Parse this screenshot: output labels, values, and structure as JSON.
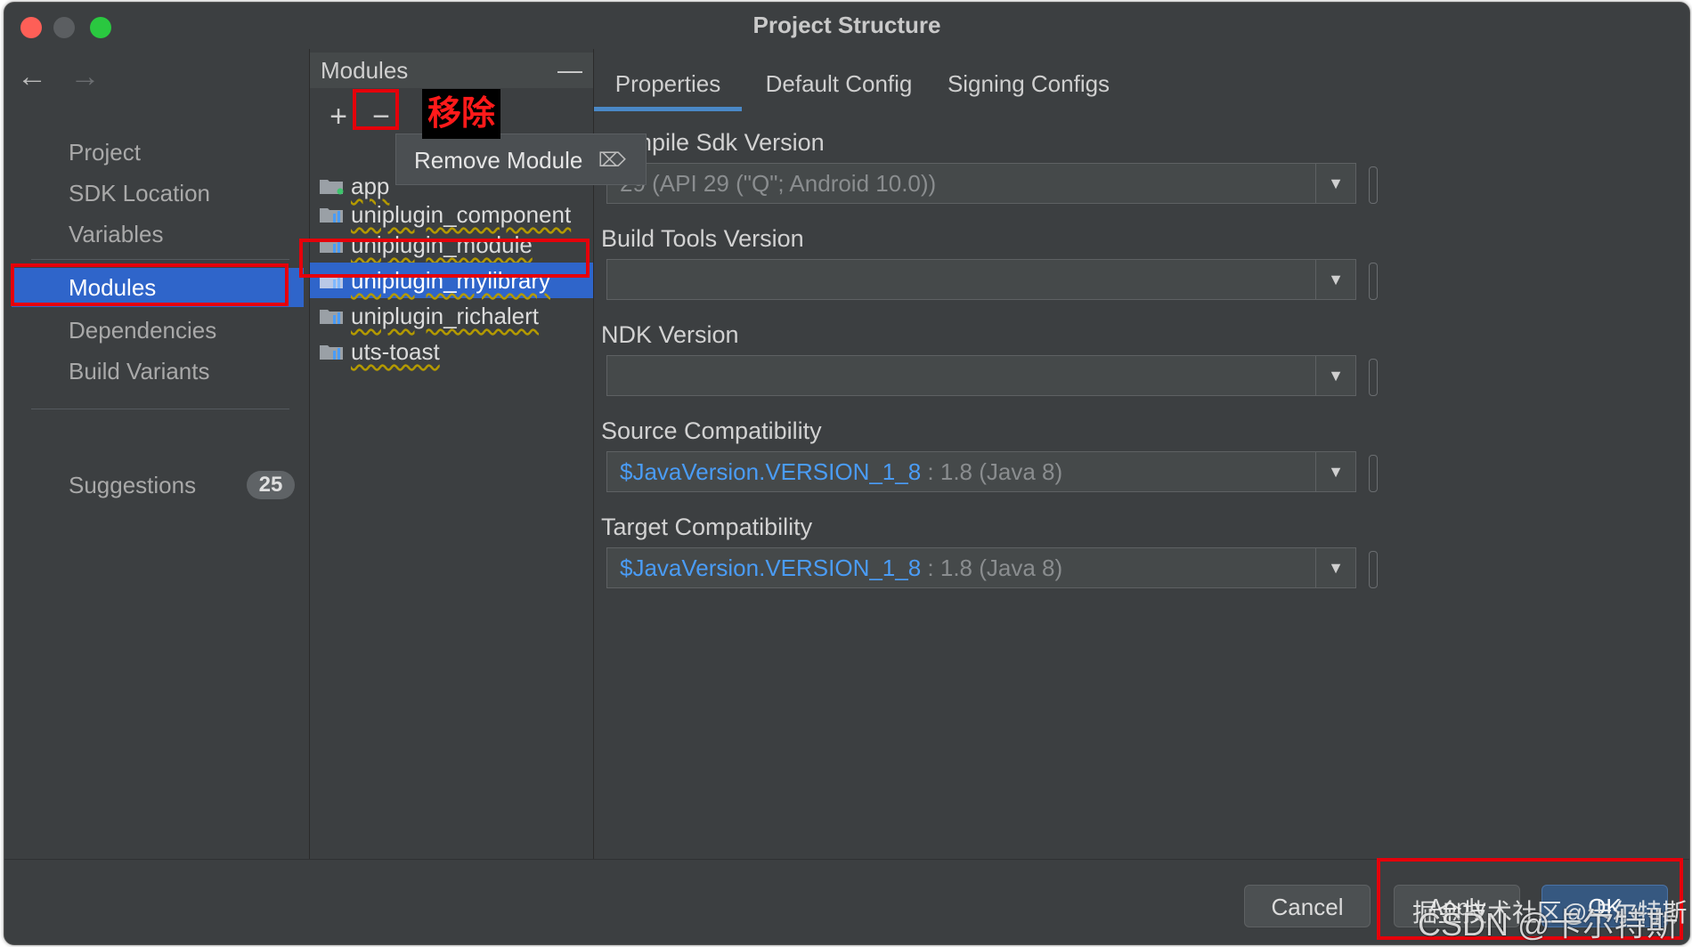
{
  "window": {
    "title": "Project Structure"
  },
  "nav": {
    "back_icon": "←",
    "forward_icon": "→",
    "items": [
      {
        "label": "Project"
      },
      {
        "label": "SDK Location"
      },
      {
        "label": "Variables"
      },
      {
        "label": "Modules",
        "selected": true
      },
      {
        "label": "Dependencies"
      },
      {
        "label": "Build Variants"
      }
    ],
    "suggestions": {
      "label": "Suggestions",
      "count": "25"
    }
  },
  "modules": {
    "header": "Modules",
    "add_icon": "+",
    "remove_icon": "−",
    "items": [
      {
        "name": "app"
      },
      {
        "name": "uniplugin_component"
      },
      {
        "name": "uniplugin_module"
      },
      {
        "name": "uniplugin_mylibrary",
        "selected": true
      },
      {
        "name": "uniplugin_richalert"
      },
      {
        "name": "uts-toast"
      }
    ],
    "tooltip": "Remove Module",
    "annotation": "移除"
  },
  "tabs": [
    {
      "label": "Properties",
      "active": true
    },
    {
      "label": "Default Config"
    },
    {
      "label": "Signing Configs"
    }
  ],
  "fields": {
    "compile_sdk": {
      "label": "Compile Sdk Version",
      "value": "29 (API 29 (\"Q\"; Android 10.0))"
    },
    "build_tools": {
      "label": "Build Tools Version",
      "value": ""
    },
    "ndk": {
      "label": "NDK Version",
      "value": ""
    },
    "source_compat": {
      "label": "Source Compatibility",
      "link": "$JavaVersion.VERSION_1_8",
      "suffix": " : 1.8 (Java 8)"
    },
    "target_compat": {
      "label": "Target Compatibility",
      "link": "$JavaVersion.VERSION_1_8",
      "suffix": " : 1.8 (Java 8)"
    }
  },
  "footer": {
    "cancel": "Cancel",
    "apply": "Apply",
    "ok": "OK"
  },
  "watermark": {
    "line1": "掘金技术社区@卡尔特斯",
    "line2": "CSDN @卡尔特斯"
  },
  "colors": {
    "accent": "#2f65ca",
    "annotation_red": "#e5000a",
    "link": "#4a9cf6"
  }
}
